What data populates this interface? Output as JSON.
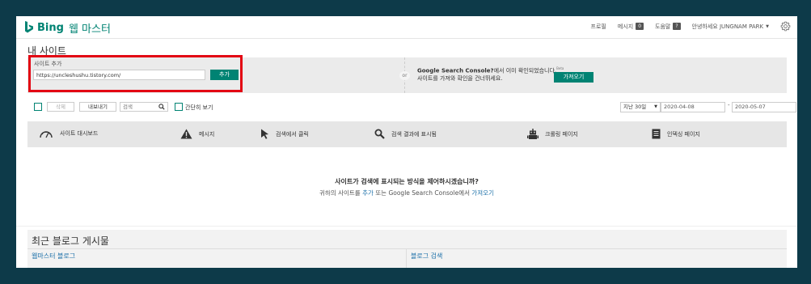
{
  "header": {
    "brand": "Bing",
    "product": "웹 마스터",
    "nav": {
      "profile": "프로필",
      "messages": "메시지",
      "messages_count": "0",
      "help": "도움말",
      "help_badge": "?",
      "greeting": "안녕하세요 JUNGNAM PARK"
    }
  },
  "page_title": "내 사이트",
  "add_site": {
    "label": "사이트 추가",
    "input_value": "https://uncleshushu.tistory.com/",
    "button": "추가",
    "or": "or",
    "gsc_title": "Google Search Console?",
    "gsc_line1_suffix": "에서 이미 확인되었습니다.",
    "beta": "Beta",
    "gsc_line2": "사이트를 가져와 확인을 건너뛰세요.",
    "import_button": "가져오기"
  },
  "toolbar": {
    "delete": "삭제",
    "export": "내보내기",
    "search_placeholder": "검색",
    "simple_view": "간단히 보기",
    "period": "지난 30일",
    "date_from": "2020-04-08",
    "date_sep": "-",
    "date_to": "2020-05-07"
  },
  "features": [
    {
      "label": "사이트 대시보드",
      "icon": "gauge-icon"
    },
    {
      "label": "메시지",
      "icon": "warning-icon"
    },
    {
      "label": "검색에서 클릭",
      "icon": "cursor-icon"
    },
    {
      "label": "검색 결과에 표시됨",
      "icon": "magnifier-icon"
    },
    {
      "label": "크롤링 페이지",
      "icon": "robot-icon"
    },
    {
      "label": "인덱싱 페이지",
      "icon": "document-icon"
    }
  ],
  "empty_state": {
    "question": "사이트가 검색에 표시되는 방식을 제어하시겠습니까?",
    "sub_prefix": "귀하의 사이트를 ",
    "sub_add": "추가",
    "sub_middle": " 또는 Google Search Console에서 ",
    "sub_import": "가져오기"
  },
  "blog": {
    "title": "최근 블로그 게시물",
    "col_left": "웹마스터 블로그",
    "col_right": "블로그 검색"
  },
  "colors": {
    "brand": "#008373",
    "highlight_border": "#e30613",
    "frame": "#0d3a49",
    "link": "#1a6fa8"
  }
}
